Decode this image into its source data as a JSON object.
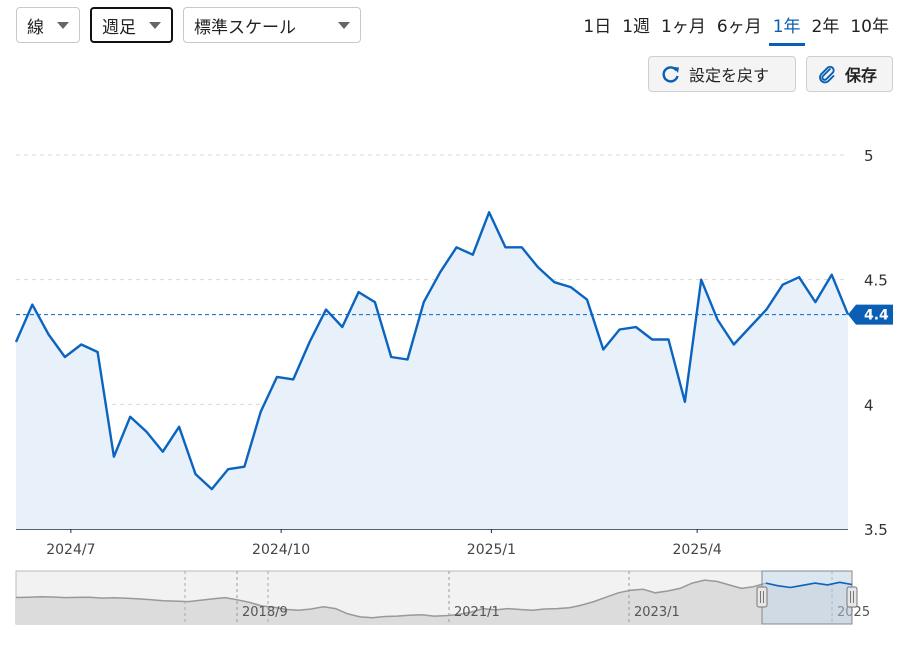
{
  "toolbar": {
    "chart_type": "線",
    "frequency": "週足",
    "scale": "標準スケール",
    "ranges": [
      {
        "label": "1日",
        "selected": false
      },
      {
        "label": "1週",
        "selected": false
      },
      {
        "label": "1ヶ月",
        "selected": false
      },
      {
        "label": "6ヶ月",
        "selected": false
      },
      {
        "label": "1年",
        "selected": true
      },
      {
        "label": "2年",
        "selected": false
      },
      {
        "label": "10年",
        "selected": false
      }
    ],
    "reset_label": "設定を戻す",
    "save_label": "保存"
  },
  "colors": {
    "line": "#0a64c0",
    "fill": "#e8f1fa",
    "accent": "#0a5fb4",
    "navigator_line": "#999999"
  },
  "icons": {
    "reset": "refresh-icon",
    "save": "paperclip-icon"
  },
  "chart_data": {
    "type": "line",
    "x_start": "2024-06-07",
    "x_end": "2025-06-06",
    "xticks": [
      {
        "label": "2024/7",
        "date": "2024-07-01"
      },
      {
        "label": "2024/10",
        "date": "2024-10-01"
      },
      {
        "label": "2025/1",
        "date": "2025-01-01"
      },
      {
        "label": "2025/4",
        "date": "2025-04-01"
      }
    ],
    "ylim": [
      3.5,
      5.0
    ],
    "yticks": [
      {
        "label": "5",
        "value": 5.0
      },
      {
        "label": "4.5",
        "value": 4.5
      },
      {
        "label": "4",
        "value": 4.0
      },
      {
        "label": "3.5",
        "value": 3.5
      }
    ],
    "grid": true,
    "current_value": 4.36,
    "current_label": "4.4",
    "series": [
      {
        "values": [
          4.25,
          4.4,
          4.28,
          4.19,
          4.24,
          4.21,
          3.79,
          3.95,
          3.89,
          3.81,
          3.91,
          3.72,
          3.66,
          3.74,
          3.75,
          3.97,
          4.11,
          4.1,
          4.25,
          4.38,
          4.31,
          4.45,
          4.41,
          4.19,
          4.18,
          4.41,
          4.53,
          4.63,
          4.6,
          4.77,
          4.63,
          4.63,
          4.55,
          4.49,
          4.47,
          4.42,
          4.22,
          4.3,
          4.31,
          4.26,
          4.26,
          4.01,
          4.5,
          4.34,
          4.24,
          4.31,
          4.38,
          4.48,
          4.51,
          4.41,
          4.52,
          4.36
        ]
      }
    ],
    "navigator": {
      "labels": [
        "2018/9",
        "2021/1",
        "2023/1",
        "2025"
      ],
      "values": [
        2.86,
        2.9,
        2.95,
        2.92,
        2.85,
        2.88,
        2.9,
        2.8,
        2.83,
        2.78,
        2.7,
        2.6,
        2.5,
        2.45,
        2.4,
        2.55,
        2.7,
        2.85,
        2.6,
        2.3,
        1.9,
        1.75,
        1.5,
        1.4,
        1.55,
        1.8,
        1.6,
        1.0,
        0.65,
        0.55,
        0.7,
        0.75,
        0.85,
        0.9,
        0.75,
        0.8,
        0.93,
        1.2,
        1.6,
        1.45,
        1.6,
        1.5,
        1.4,
        1.55,
        1.6,
        1.7,
        2.0,
        2.4,
        2.9,
        3.4,
        3.7,
        3.8,
        3.4,
        3.6,
        3.9,
        4.5,
        4.85,
        4.7,
        4.3,
        3.9,
        4.1,
        4.5,
        4.2,
        4.0,
        4.25,
        4.5,
        4.3,
        4.6,
        4.35
      ]
    }
  }
}
